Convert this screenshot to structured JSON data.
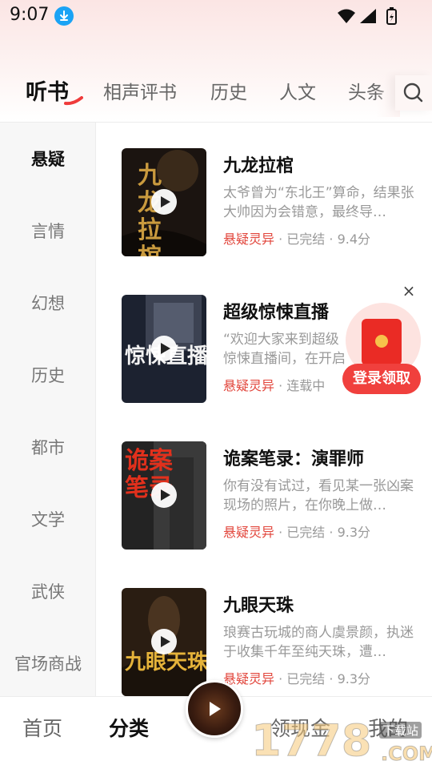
{
  "status_bar": {
    "time": "9:07"
  },
  "tabs": [
    {
      "label": "听书",
      "active": true
    },
    {
      "label": "相声评书",
      "active": false
    },
    {
      "label": "历史",
      "active": false
    },
    {
      "label": "人文",
      "active": false
    },
    {
      "label": "头条",
      "active": false
    }
  ],
  "sidebar": {
    "items": [
      {
        "label": "悬疑",
        "active": true
      },
      {
        "label": "言情",
        "active": false
      },
      {
        "label": "幻想",
        "active": false
      },
      {
        "label": "历史",
        "active": false
      },
      {
        "label": "都市",
        "active": false
      },
      {
        "label": "文学",
        "active": false
      },
      {
        "label": "武侠",
        "active": false
      },
      {
        "label": "官场商战",
        "active": false
      }
    ]
  },
  "books": [
    {
      "title": "九龙拉棺",
      "desc": "太爷曾为“东北王”算命，结果张大帅因为会错意，最终导…",
      "genre": "悬疑灵异",
      "status": "已完结",
      "score": "9.4分",
      "cover": {
        "text": "九龙拉棺",
        "bg": "#1b1410",
        "fg": "#c99a3e"
      }
    },
    {
      "title": "超级惊悚直播",
      "desc": "“欢迎大家来到超级惊悚直播间，在开启今天的直播之前…",
      "genre": "悬疑灵异",
      "status": "连载中",
      "score": "",
      "cover": {
        "text": "惊悚直播",
        "bg": "#1c2230",
        "fg": "#f2f2f2"
      }
    },
    {
      "title": "诡案笔录：演罪师",
      "desc": "你有没有试过，看见某一张凶案现场的照片，在你晚上做…",
      "genre": "悬疑灵异",
      "status": "已完结",
      "score": "9.3分",
      "cover": {
        "text": "诡案笔录",
        "bg": "#232323",
        "fg": "#e2301c"
      }
    },
    {
      "title": "九眼天珠",
      "desc": "琅赛古玩城的商人虞景颜，执迷于收集千年至纯天珠，遭…",
      "genre": "悬疑灵异",
      "status": "已完结",
      "score": "9.3分",
      "cover": {
        "text": "九眼天珠",
        "bg": "#2a1d12",
        "fg": "#e5b33a"
      }
    }
  ],
  "promo": {
    "close": "×",
    "label": "登录领取"
  },
  "bottom_nav": [
    {
      "label": "首页",
      "active": false
    },
    {
      "label": "分类",
      "active": true
    },
    {
      "label": "领现金",
      "active": false
    },
    {
      "label": "我的",
      "active": false
    }
  ],
  "watermark": {
    "text": "1778",
    "site": "下载站",
    "domain": ".COM"
  },
  "colors": {
    "accent": "#e2463c",
    "promo_red": "#f0403d",
    "sidebar_bg": "#f7f7f7"
  }
}
